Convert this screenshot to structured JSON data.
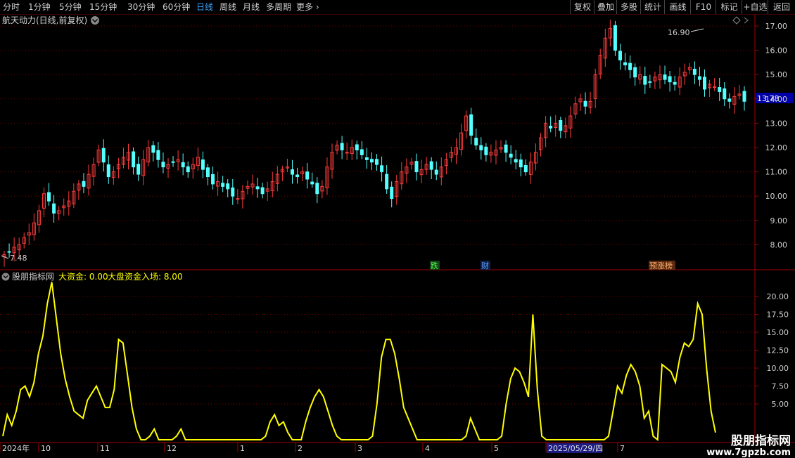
{
  "toolbar": {
    "periods": [
      "分时",
      "1分钟",
      "5分钟",
      "15分钟",
      "30分钟",
      "60分钟",
      "日线",
      "周线",
      "月线",
      "多周期",
      "更多"
    ],
    "active": "日线",
    "right": [
      "复权",
      "叠加",
      "多股",
      "统计",
      "画线",
      "F10",
      "标记",
      "+自选",
      "返回"
    ]
  },
  "main_panel": {
    "title": "航天动力(日线,前复权)",
    "price_axis": [
      "17.00",
      "16.00",
      "15.00",
      "14.00",
      "13.00",
      "12.00",
      "11.00",
      "10.00",
      "9.00",
      "8.00"
    ],
    "current_price": "13.78",
    "high_label": "16.90",
    "low_label": "7.48",
    "events": [
      "跌",
      "财",
      "预涨榜"
    ]
  },
  "indicator_panel": {
    "title": "股朋指标网",
    "label1": "大资金: 0.00",
    "label2": "大盘资金入场: 8.00",
    "value_axis": [
      "20.00",
      "17.50",
      "15.00",
      "12.50",
      "10.00",
      "7.50",
      "5.00"
    ]
  },
  "time_axis": {
    "labels": [
      "2024年",
      "10",
      "11",
      "12",
      "1",
      "2",
      "3",
      "4",
      "5",
      "2025/05/29/四",
      "7"
    ]
  },
  "watermark": {
    "text": "股朋指标网",
    "url": "www.7gpzb.com"
  },
  "colors": {
    "up": "#ff3c3c",
    "down": "#54ffff",
    "indicator": "#ffff00",
    "grid": "#7a0000",
    "axis": "#a00000",
    "active": "#3fa7ff"
  },
  "chart_data": [
    {
      "type": "candlestick",
      "title": "航天动力(日线,前复权)",
      "ylim": [
        7.2,
        17.4
      ],
      "close": [
        7.6,
        7.7,
        7.9,
        8.0,
        8.3,
        8.5,
        8.9,
        9.4,
        10.1,
        9.8,
        9.3,
        9.4,
        9.6,
        9.8,
        10.2,
        10.5,
        10.4,
        10.9,
        11.3,
        11.9,
        11.4,
        10.8,
        11.0,
        11.3,
        11.6,
        11.8,
        11.2,
        10.9,
        11.5,
        12.0,
        11.8,
        11.5,
        11.2,
        11.3,
        11.4,
        11.5,
        11.2,
        11.0,
        11.3,
        11.6,
        11.1,
        10.8,
        10.5,
        10.6,
        10.4,
        10.3,
        10.0,
        9.9,
        10.2,
        10.4,
        10.5,
        10.3,
        10.1,
        10.3,
        10.6,
        10.9,
        11.1,
        11.2,
        10.9,
        10.8,
        11.0,
        10.7,
        10.5,
        10.1,
        10.4,
        11.2,
        11.8,
        12.1,
        11.9,
        11.8,
        12.0,
        11.9,
        11.7,
        11.5,
        11.4,
        11.3,
        11.0,
        10.3,
        9.9,
        10.6,
        11.0,
        11.2,
        11.4,
        11.0,
        11.1,
        11.3,
        11.1,
        10.9,
        11.2,
        11.5,
        11.8,
        12.0,
        12.6,
        13.3,
        12.5,
        12.1,
        11.9,
        11.7,
        11.8,
        11.9,
        12.0,
        11.8,
        11.6,
        11.4,
        11.2,
        11.0,
        11.4,
        11.8,
        12.4,
        13.0,
        12.8,
        13.0,
        12.7,
        12.9,
        13.3,
        13.8,
        14.0,
        13.7,
        13.9,
        15.0,
        15.8,
        16.5,
        16.9,
        16.0,
        15.6,
        15.4,
        15.2,
        14.9,
        15.0,
        14.6,
        14.7,
        14.9,
        15.0,
        14.8,
        14.7,
        14.6,
        14.9,
        15.1,
        15.3,
        15.0,
        14.8,
        14.4,
        14.6,
        14.5,
        14.3,
        14.0,
        13.9,
        14.1,
        14.2,
        13.9
      ],
      "high_label": 16.9,
      "low_label": 7.48,
      "current": 13.78
    },
    {
      "type": "line",
      "series": [
        {
          "name": "大资金",
          "values": [
            0.5,
            3.5,
            2.0,
            4.0,
            7.0,
            7.5,
            6.0,
            8.0,
            12.0,
            14.5,
            19.0,
            22.0,
            17.0,
            12.0,
            8.5,
            6.0,
            4.0,
            3.5,
            3.0,
            5.5,
            6.5,
            7.5,
            6.0,
            4.5,
            4.5,
            7.0,
            14.0,
            13.5,
            9.0,
            4.5,
            1.5,
            0.0,
            0.0,
            0.5,
            1.5,
            0.0,
            0.0,
            0.0,
            0.0,
            0.5,
            1.5,
            0.0,
            0.0,
            0.0,
            0.0,
            0.0,
            0.0,
            0.0,
            0.0,
            0.0,
            0.0,
            0.0,
            0.0,
            0.0,
            0.0,
            0.0,
            0.0,
            0.0,
            0.0,
            0.5,
            2.5,
            3.5,
            2.0,
            2.5,
            1.0,
            0.0,
            0.0,
            0.0,
            2.5,
            4.5,
            6.0,
            7.0,
            6.0,
            4.0,
            2.0,
            0.5,
            0.0,
            0.0,
            0.0,
            0.0,
            0.0,
            0.0,
            0.0,
            0.5,
            5.0,
            11.5,
            14.0,
            14.0,
            12.0,
            8.5,
            4.5,
            3.0,
            1.5,
            0.0,
            0.0,
            0.0,
            0.0,
            0.0,
            0.0,
            0.0,
            0.0,
            0.0,
            0.0,
            0.0,
            0.5,
            3.0,
            1.5,
            0.0,
            0.0,
            0.0,
            0.0,
            0.0,
            0.5,
            5.0,
            8.5,
            10.0,
            9.5,
            8.0,
            6.0,
            17.5,
            7.0,
            0.5,
            0.0,
            0.0,
            0.0,
            0.0,
            0.0,
            0.0,
            0.0,
            0.0,
            0.0,
            0.0,
            0.0,
            0.0,
            0.0,
            0.0,
            0.5,
            4.0,
            7.5,
            6.5,
            9.0,
            10.5,
            9.5,
            7.5,
            3.0,
            4.0,
            0.5,
            0.0,
            10.5,
            10.0,
            9.5,
            8.0,
            11.5,
            13.5,
            13.0,
            14.0,
            19.0,
            17.5,
            10.0,
            4.0,
            1.0
          ]
        },
        {
          "name": "大盘资金入场",
          "values": []
        }
      ],
      "ylim": [
        0,
        23
      ],
      "y_ticks": [
        5,
        7.5,
        10,
        12.5,
        15,
        17.5,
        20
      ]
    }
  ]
}
